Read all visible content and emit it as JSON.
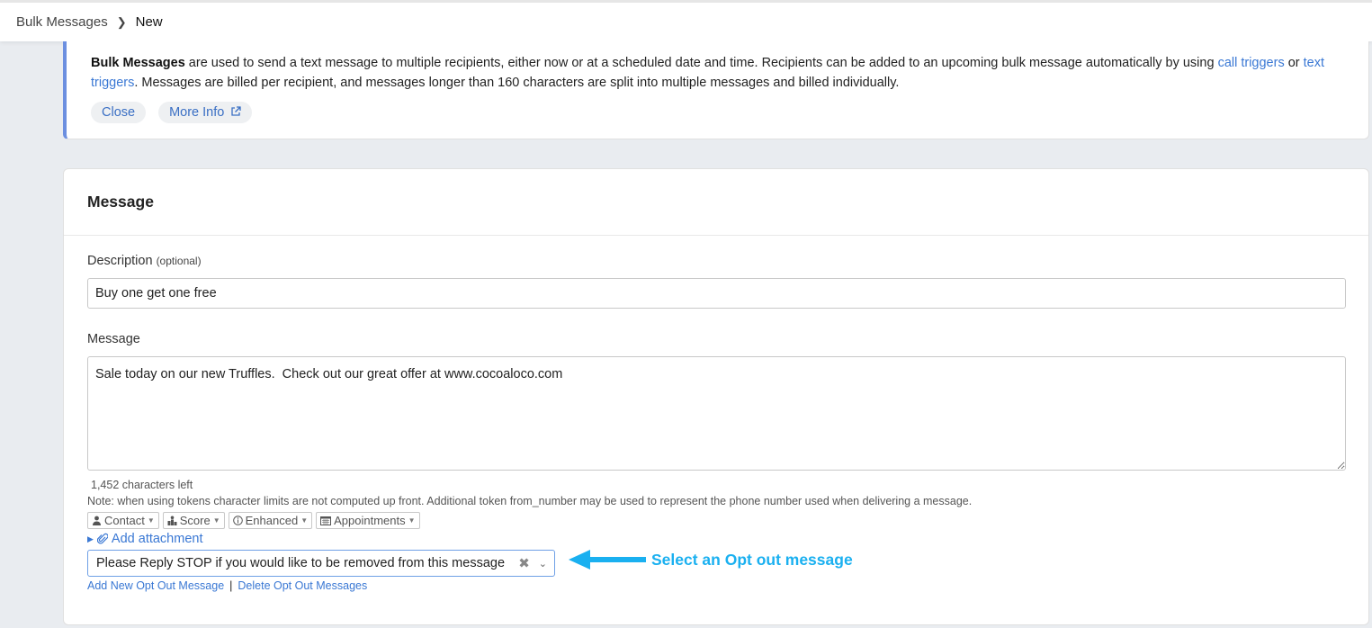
{
  "breadcrumb": {
    "parent": "Bulk Messages",
    "current": "New"
  },
  "info": {
    "bold": "Bulk Messages",
    "text1": " are used to send a text message to multiple recipients, either now or at a scheduled date and time. Recipients can be added to an upcoming bulk message automatically by using ",
    "link1": "call triggers",
    "text2": " or ",
    "link2": "text triggers",
    "text3": ". Messages are billed per recipient, and messages longer than 160 characters are split into multiple messages and billed individually.",
    "close_label": "Close",
    "more_info_label": "More Info"
  },
  "card": {
    "title": "Message"
  },
  "description": {
    "label": "Description",
    "hint": "(optional)",
    "value": "Buy one get one free"
  },
  "message": {
    "label": "Message",
    "value": "Sale today on our new Truffles.  Check out our great offer at www.cocoaloco.com",
    "chars_left": "1,452 characters left",
    "note": "Note: when using tokens character limits are not computed up front. Additional token from_number may be used to represent the phone number used when delivering a message."
  },
  "tokens": [
    {
      "label": "Contact",
      "icon": "person-icon"
    },
    {
      "label": "Score",
      "icon": "podium-icon"
    },
    {
      "label": "Enhanced",
      "icon": "info-circle-icon"
    },
    {
      "label": "Appointments",
      "icon": "calendar-icon"
    }
  ],
  "attachment": {
    "label": "Add attachment"
  },
  "opt_out": {
    "selected": "Please Reply STOP if you would like to be removed from this message",
    "add_label": "Add New Opt Out Message",
    "delete_label": "Delete Opt Out Messages"
  },
  "annotation": {
    "text": "Select an Opt out message",
    "color": "#1ab0f0"
  }
}
